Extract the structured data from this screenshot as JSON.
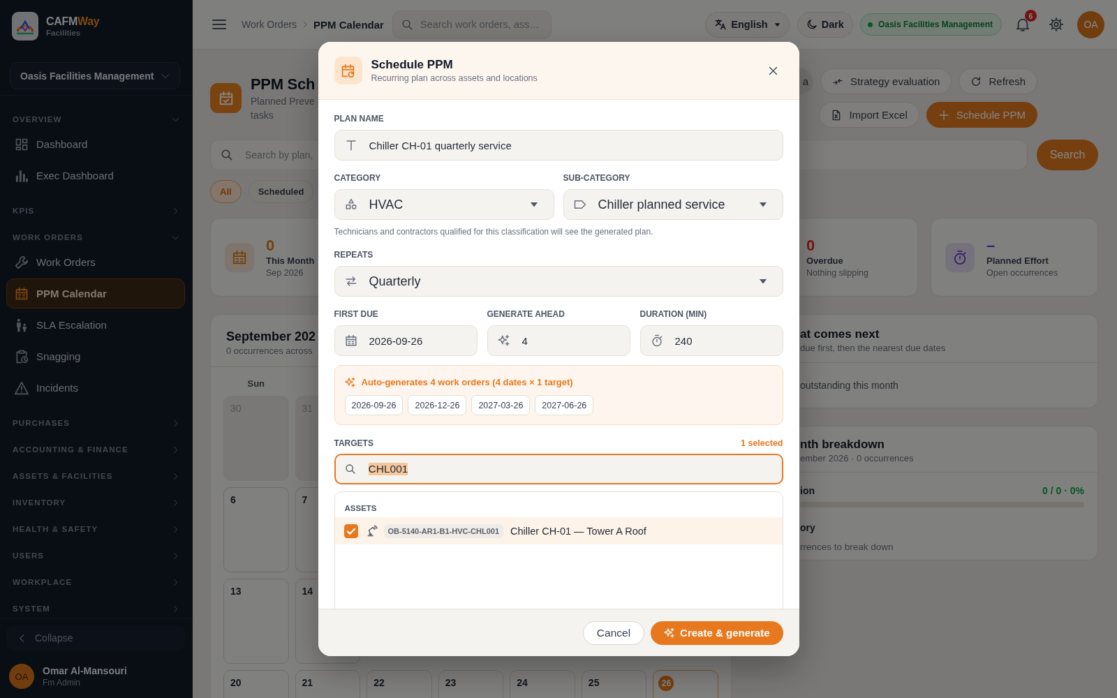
{
  "sidebar": {
    "brand": {
      "name": "CAFM",
      "accent": "Way",
      "tagline": "Facilities"
    },
    "org_select": "Oasis Facilities Management",
    "sections": [
      {
        "title": "OVERVIEW",
        "expanded": true,
        "items": [
          {
            "label": "Dashboard",
            "selected": false
          },
          {
            "label": "Exec Dashboard",
            "selected": false
          }
        ]
      },
      {
        "title": "KPIS",
        "expanded": false
      },
      {
        "title": "WORK ORDERS",
        "expanded": true,
        "items": [
          {
            "label": "Work Orders",
            "selected": false
          },
          {
            "label": "PPM Calendar",
            "selected": true
          },
          {
            "label": "SLA Escalation",
            "selected": false
          },
          {
            "label": "Snagging",
            "selected": false
          },
          {
            "label": "Incidents",
            "selected": false
          }
        ]
      },
      {
        "title": "PURCHASES",
        "expanded": false
      },
      {
        "title": "ACCOUNTING & FINANCE",
        "expanded": false
      },
      {
        "title": "ASSETS & FACILITIES",
        "expanded": false
      },
      {
        "title": "INVENTORY",
        "expanded": false
      },
      {
        "title": "HEALTH & SAFETY",
        "expanded": false
      },
      {
        "title": "USERS",
        "expanded": false
      },
      {
        "title": "WORKPLACE",
        "expanded": false
      },
      {
        "title": "SYSTEM",
        "expanded": false
      }
    ],
    "collapse_button": "Collapse",
    "user": {
      "initials": "OA",
      "name": "Omar Al-Mansouri",
      "role": "Fm Admin"
    }
  },
  "topbar": {
    "breadcrumb": [
      "Work Orders",
      "PPM Calendar"
    ],
    "search": {
      "placeholder": "Search work orders, ass…"
    },
    "language": "English",
    "theme": "Dark",
    "org_badge": "Oasis Facilities Management",
    "notification_count": "6",
    "avatar_initials": "OA"
  },
  "page_header": {
    "title": "PPM Sch",
    "subtitle_lines": [
      "Planned Preve",
      "tasks"
    ],
    "action_rows": [
      [
        {
          "label": "a",
          "kind": "secondary"
        },
        {
          "label": "Strategy evaluation",
          "kind": "outline"
        },
        {
          "label": "Refresh",
          "kind": "outline"
        }
      ],
      [
        {
          "label": "Import Excel",
          "kind": "outline"
        },
        {
          "label": "Schedule PPM",
          "kind": "primary"
        }
      ]
    ]
  },
  "search_bar": {
    "placeholder": "Search by plan,",
    "button": "Search"
  },
  "filters": [
    {
      "label": "All",
      "selected": true
    },
    {
      "label": "Scheduled",
      "selected": false
    }
  ],
  "stats": [
    {
      "value": "0",
      "label": "This Month",
      "sub": "Sep 2026",
      "color": "#74400e"
    },
    {
      "value": "0",
      "label": "Overdue",
      "sub": "Nothing slipping",
      "color": "#721414"
    },
    {
      "value": "–",
      "label": "Planned Effort",
      "sub": "Open occurrences",
      "color": "#39216d"
    }
  ],
  "calendar": {
    "title": "September 202",
    "subtitle": "0 occurrences across",
    "weekdays": [
      "Sun"
    ],
    "weeks": [
      [
        {
          "day": "30",
          "outside": true,
          "today": false
        },
        {
          "day": "31",
          "outside": true,
          "today": false
        }
      ],
      [
        {
          "day": "6",
          "outside": false,
          "today": false
        },
        {
          "day": "7",
          "outside": false,
          "today": false
        }
      ],
      [
        {
          "day": "13",
          "outside": false,
          "today": false
        },
        {
          "day": "14",
          "outside": false,
          "today": false
        }
      ],
      [
        {
          "day": "20",
          "outside": false,
          "today": false
        },
        {
          "day": "21",
          "outside": false,
          "today": false
        },
        {
          "day": "22",
          "outside": false,
          "today": false
        },
        {
          "day": "23",
          "outside": false,
          "today": false
        },
        {
          "day": "24",
          "outside": false,
          "today": false
        },
        {
          "day": "25",
          "outside": false,
          "today": false
        },
        {
          "day": "26",
          "outside": false,
          "today": true
        }
      ]
    ]
  },
  "next_panel": {
    "title": "at comes next",
    "subtitle": "due first, then the nearest due dates",
    "empty_text": "outstanding this month"
  },
  "breakdown_panel": {
    "title": "nth breakdown",
    "subtitle": "ember 2026 · 0 occurrences",
    "completion": {
      "label": "ion",
      "value": "0 / 0 · 0%",
      "level": 0
    },
    "category": {
      "label": "ory",
      "empty_text": "rrences to break down"
    }
  },
  "modal": {
    "title": "Schedule PPM",
    "subtitle": "Recurring plan across assets and locations",
    "plan_name": {
      "label": "PLAN NAME",
      "value": "Chiller CH-01 quarterly service"
    },
    "category": {
      "label": "CATEGORY",
      "value": "HVAC"
    },
    "sub_category": {
      "label": "SUB-CATEGORY",
      "value": "Chiller planned service"
    },
    "classification_hint": "Technicians and contractors qualified for this classification will see the generated plan.",
    "repeats": {
      "label": "REPEATS",
      "value": "Quarterly"
    },
    "first_due": {
      "label": "FIRST DUE",
      "value": "2026-09-26"
    },
    "generate_ahead": {
      "label": "GENERATE AHEAD",
      "value": "4"
    },
    "duration": {
      "label": "DURATION (MIN)",
      "value": "240"
    },
    "preview": {
      "summary": "Auto-generates 4 work orders (4 dates × 1 target)",
      "dates": [
        "2026-09-26",
        "2026-12-26",
        "2027-03-26",
        "2027-06-26"
      ]
    },
    "targets": {
      "label": "TARGETS",
      "selected_count": "1 selected",
      "search": {
        "value": "CHL001",
        "value_highlighted": true
      },
      "groups": [
        {
          "title": "ASSETS",
          "items": [
            {
              "code": "OB-5140-AR1-B1-HVC-CHL001",
              "name": "Chiller CH-01 — Tower A Roof",
              "checked": true
            }
          ]
        }
      ]
    },
    "buttons": {
      "cancel": "Cancel",
      "submit": "Create & generate"
    }
  }
}
